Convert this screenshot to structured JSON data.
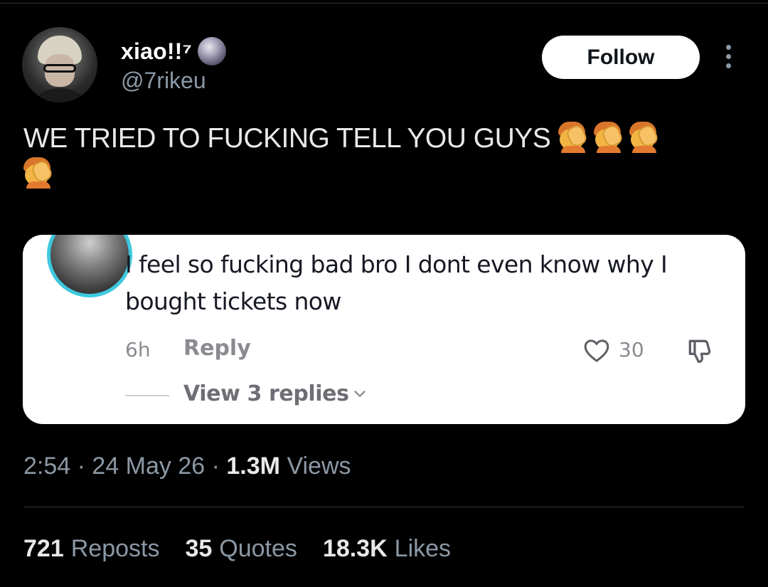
{
  "user": {
    "display_name": "xiao!!⁷",
    "handle": "@7rikeu",
    "badge_icon": "moon-icon",
    "follow_label": "Follow"
  },
  "tweet": {
    "text": "WE TRIED TO FUCKING TELL YOU GUYS",
    "emoji": "face-palm-emoji",
    "emoji_count": 4
  },
  "embedded_comment": {
    "text": "I feel so fucking bad bro I dont even know why I bought tickets now",
    "time": "6h",
    "reply_label": "Reply",
    "likes": "30",
    "view_replies_label": "View 3 replies"
  },
  "meta": {
    "time": "2:54",
    "date": "24 May 26",
    "views_count": "1.3M",
    "views_label": "Views"
  },
  "stats": {
    "reposts_count": "721",
    "reposts_label": "Reposts",
    "quotes_count": "35",
    "quotes_label": "Quotes",
    "likes_count": "18.3K",
    "likes_label": "Likes"
  }
}
